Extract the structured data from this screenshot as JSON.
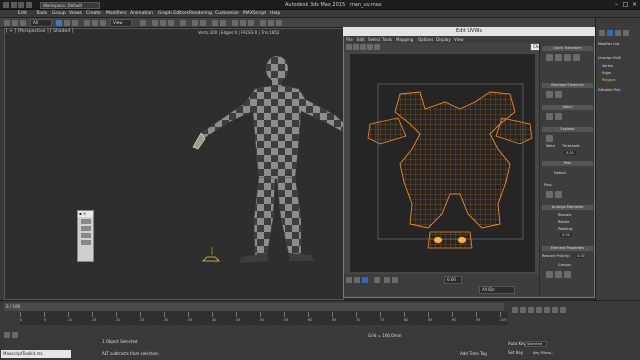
{
  "window": {
    "title": "Autodesk 3ds Max 2015",
    "file": "man_uv.max",
    "workspace": "Workspace: Default"
  },
  "menu": [
    "Edit",
    "Tools",
    "Group",
    "Views",
    "Create",
    "Modifiers",
    "Animation",
    "Graph Editors",
    "Rendering",
    "Customize",
    "MAXScript",
    "Help"
  ],
  "toolbar": {
    "filter": "All",
    "view": "View"
  },
  "viewport": {
    "label": "[ + ] [Perspective ] [ Shaded ]",
    "stats": "Verts:300 | Edges:0 | FACES:0 | Tris:1852"
  },
  "uvw": {
    "title": "Edit UVWs",
    "menu": [
      "File",
      "Edit",
      "Select",
      "Tools",
      "Mapping",
      "Options",
      "Display",
      "View"
    ],
    "checker": "CheckerPattern ( Checker )",
    "all_ids": "All IDs",
    "zoom": "0.00",
    "panel": {
      "quick_transform": "Quick Transform",
      "reshape": "Reshape Elements",
      "stitch": "Stitch",
      "explode": "Explode",
      "weld": "Weld",
      "threshold_label": "Threshold:",
      "threshold": "0.01",
      "peel": "Peel",
      "detach": "Detach",
      "pins": "Pins:",
      "arrange": "Arrange Elements",
      "rescale": "Rescale",
      "rotate": "Rotate",
      "padding_label": "Padding:",
      "padding": "0.00",
      "element_props": "Element Properties",
      "rescale_priority": "Rescale Priority:",
      "rescale_priority_value": "0.00",
      "groups": "Groups:"
    }
  },
  "command_panel": {
    "modifier_label": "Modifier List",
    "items": [
      "Unwrap UVW",
      "Vertex",
      "Edge",
      "Polygon",
      "Editable Poly"
    ]
  },
  "timeline": {
    "frame": "0 / 100",
    "ticks": [
      "0",
      "5",
      "10",
      "15",
      "20",
      "25",
      "30",
      "35",
      "40",
      "45",
      "50",
      "55",
      "60",
      "65",
      "70",
      "75",
      "80",
      "85",
      "90",
      "95",
      "100"
    ]
  },
  "status": {
    "maxscript": "MaxscriptToolkit.ms",
    "selection": "1 Object Selected",
    "prompt": "ALT subtracts from selection",
    "grid": "Grid = 100.0mm",
    "auto_key": "Auto Key",
    "auto_key_mode": "Selected",
    "set_key": "Set Key",
    "key_filters": "Key Filters...",
    "add_time_tag": "Add Time Tag"
  },
  "colors": {
    "accent": "#f08a1e",
    "uv_wire": "#e07810",
    "selected_blue": "#2a6cc8",
    "checker_dark": "#3d3d3d",
    "checker_light": "#8d8d8d"
  }
}
